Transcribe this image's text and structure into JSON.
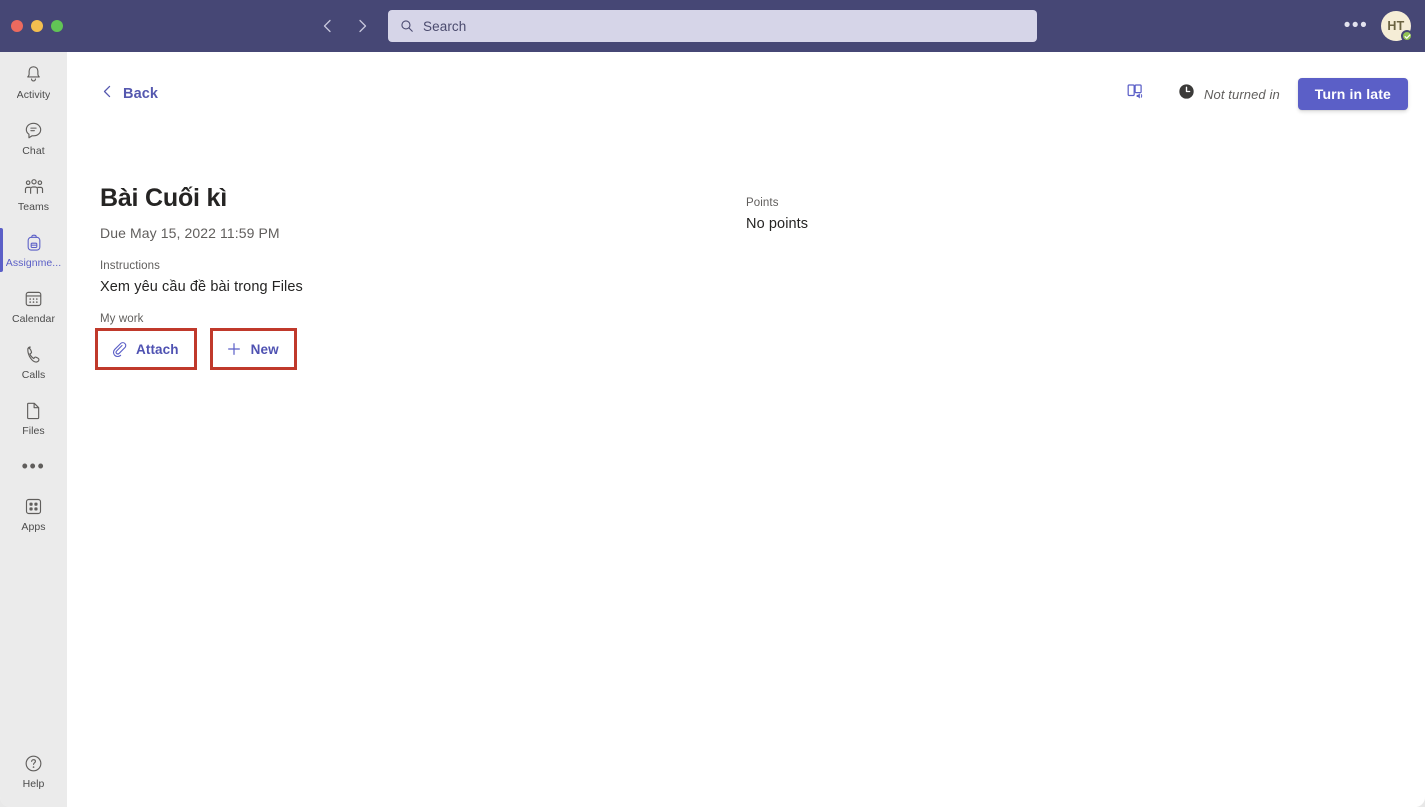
{
  "window": {
    "traffic_lights": [
      "close",
      "minimize",
      "maximize"
    ]
  },
  "titlebar": {
    "back_nav_icon": "chevron-left-icon",
    "forward_nav_icon": "chevron-right-icon",
    "search": {
      "icon": "search-icon",
      "placeholder": "Search",
      "value": "Search"
    },
    "more_label": "•••",
    "avatar": {
      "initials": "HT",
      "presence": "available"
    }
  },
  "sidebar": {
    "items": [
      {
        "label": "Activity",
        "icon": "bell-icon",
        "active": false
      },
      {
        "label": "Chat",
        "icon": "chat-icon",
        "active": false
      },
      {
        "label": "Teams",
        "icon": "teams-icon",
        "active": false
      },
      {
        "label": "Assignme...",
        "icon": "backpack-icon",
        "active": true
      },
      {
        "label": "Calendar",
        "icon": "calendar-icon",
        "active": false
      },
      {
        "label": "Calls",
        "icon": "phone-icon",
        "active": false
      },
      {
        "label": "Files",
        "icon": "file-icon",
        "active": false
      }
    ],
    "more_label": "•••",
    "apps": {
      "label": "Apps",
      "icon": "apps-grid-icon"
    },
    "help": {
      "label": "Help",
      "icon": "help-circle-icon"
    }
  },
  "header": {
    "back_label": "Back",
    "back_icon": "chevron-left-icon",
    "immersive_reader_icon": "immersive-reader-icon",
    "status_icon": "clock-icon",
    "status_label": "Not turned in",
    "turn_in_label": "Turn in late"
  },
  "assignment": {
    "title": "Bài Cuối kì",
    "due": "Due May 15, 2022 11:59 PM",
    "points_label": "Points",
    "points_value": "No points",
    "instructions_label": "Instructions",
    "instructions_value": "Xem yêu cầu đề bài trong Files",
    "my_work_label": "My work",
    "attach_label": "Attach",
    "attach_icon": "paperclip-icon",
    "new_label": "New",
    "new_icon": "plus-icon"
  },
  "colors": {
    "titlebar": "#464775",
    "accent": "#5b5fc7",
    "accent_text": "#4f52b2",
    "sidebar": "#ebebeb",
    "annotation_red": "#c0392b",
    "presence_green": "#92c353",
    "avatar_bg": "#f5edd6"
  }
}
